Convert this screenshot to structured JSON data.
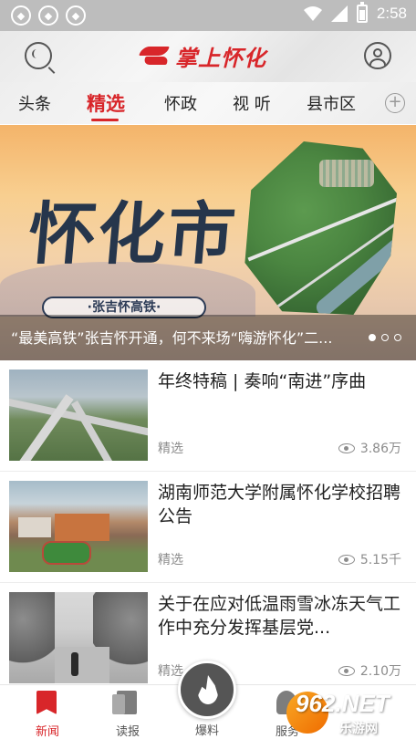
{
  "status_bar": {
    "time": "2:58",
    "left_icons": [
      "notification-icon",
      "notification-icon",
      "notification-icon"
    ]
  },
  "header": {
    "logo_text": "掌上怀化",
    "search_icon": "search-icon",
    "user_icon": "user-icon"
  },
  "tabs": [
    {
      "label": "头条",
      "active": false
    },
    {
      "label": "精选",
      "active": true
    },
    {
      "label": "怀政",
      "active": false
    },
    {
      "label": "视 听",
      "active": false
    },
    {
      "label": "县市区",
      "active": false
    }
  ],
  "banner": {
    "calligraphy": "怀化市",
    "pill_text": "·张吉怀高铁·",
    "title": "“最美高铁”张吉怀开通，何不来场“嗨游怀化”二..."
  },
  "feed": [
    {
      "title": "年终特稿 | 奏响“南进”序曲",
      "category": "精选",
      "views": "3.86万"
    },
    {
      "title": "湖南师范大学附属怀化学校招聘公告",
      "category": "精选",
      "views": "5.15千"
    },
    {
      "title": "关于在应对低温雨雪冰冻天气工作中充分发挥基层党...",
      "category": "精选",
      "views": "2.10万"
    }
  ],
  "bottom_nav": {
    "news": "新闻",
    "read": "读报",
    "baoliao": "爆料",
    "service": "服务"
  },
  "watermark": {
    "number": "962.NET",
    "sub": "乐游网"
  },
  "colors": {
    "accent": "#d8262a",
    "muted": "#8c8c8c"
  }
}
